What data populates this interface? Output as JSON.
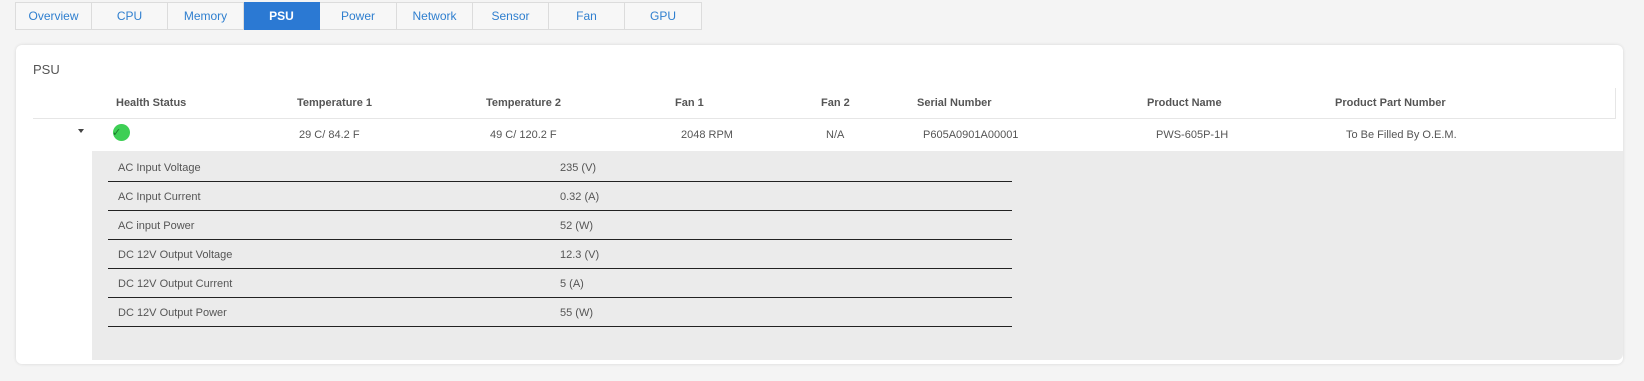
{
  "tabs": [
    {
      "label": "Overview",
      "active": false
    },
    {
      "label": "CPU",
      "active": false
    },
    {
      "label": "Memory",
      "active": false
    },
    {
      "label": "PSU",
      "active": true
    },
    {
      "label": "Power",
      "active": false
    },
    {
      "label": "Network",
      "active": false
    },
    {
      "label": "Sensor",
      "active": false
    },
    {
      "label": "Fan",
      "active": false
    },
    {
      "label": "GPU",
      "active": false
    }
  ],
  "card": {
    "title": "PSU"
  },
  "table": {
    "columns": [
      "Health Status",
      "Temperature 1",
      "Temperature 2",
      "Fan 1",
      "Fan 2",
      "Serial Number",
      "Product Name",
      "Product Part Number"
    ],
    "row": {
      "health": "ok",
      "health_icon": "check-circle-icon",
      "health_color": "#3ecf55",
      "temperature1": "29 C/ 84.2 F",
      "temperature2": "49 C/ 120.2 F",
      "fan1": "2048 RPM",
      "fan2": "N/A",
      "serial_number": "P605A0901A00001",
      "product_name": "PWS-605P-1H",
      "product_part_number": "To Be Filled By O.E.M."
    }
  },
  "details": [
    {
      "label": "AC Input Voltage",
      "value": "235 (V)"
    },
    {
      "label": "AC Input Current",
      "value": "0.32 (A)"
    },
    {
      "label": "AC input Power",
      "value": "52 (W)"
    },
    {
      "label": "DC 12V Output Voltage",
      "value": "12.3 (V)"
    },
    {
      "label": "DC 12V Output Current",
      "value": "5 (A)"
    },
    {
      "label": "DC 12V Output Power",
      "value": "55 (W)"
    }
  ],
  "colors": {
    "accent": "#2b79d3",
    "tab_text": "#2f7fcf",
    "ok": "#3ecf55"
  }
}
